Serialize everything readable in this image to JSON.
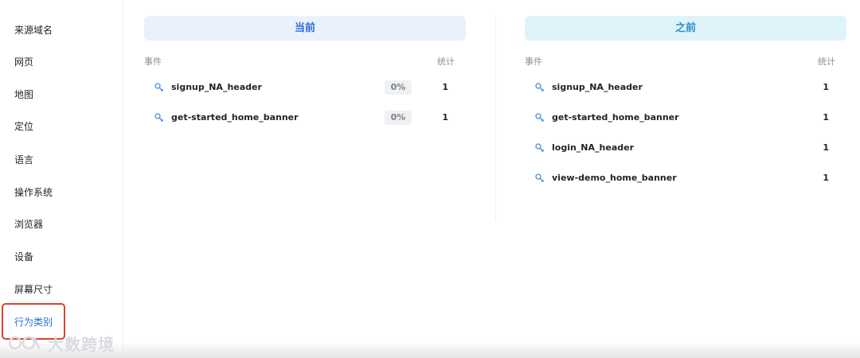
{
  "sidebar": {
    "items": [
      {
        "label": "来源域名"
      },
      {
        "label": "网页"
      },
      {
        "label": "地图"
      },
      {
        "label": "定位"
      },
      {
        "label": "语言"
      },
      {
        "label": "操作系统"
      },
      {
        "label": "浏览器"
      },
      {
        "label": "设备"
      },
      {
        "label": "屏幕尺寸"
      },
      {
        "label": "行为类别"
      }
    ],
    "active_index": 9
  },
  "current": {
    "title": "当前",
    "col_event": "事件",
    "col_count": "统计",
    "rows": [
      {
        "name": "signup_NA_header",
        "percent": "0%",
        "count": "1"
      },
      {
        "name": "get-started_home_banner",
        "percent": "0%",
        "count": "1"
      }
    ]
  },
  "previous": {
    "title": "之前",
    "col_event": "事件",
    "col_count": "统计",
    "rows": [
      {
        "name": "signup_NA_header",
        "count": "1"
      },
      {
        "name": "get-started_home_banner",
        "count": "1"
      },
      {
        "name": "login_NA_header",
        "count": "1"
      },
      {
        "name": "view-demo_home_banner",
        "count": "1"
      }
    ]
  },
  "watermark": {
    "text": "大数跨境"
  },
  "colors": {
    "accent": "#2f6bd6",
    "active_outline": "#d9432f",
    "current_head_bg": "#e9f1fd",
    "previous_head_bg": "#dff3fa"
  }
}
